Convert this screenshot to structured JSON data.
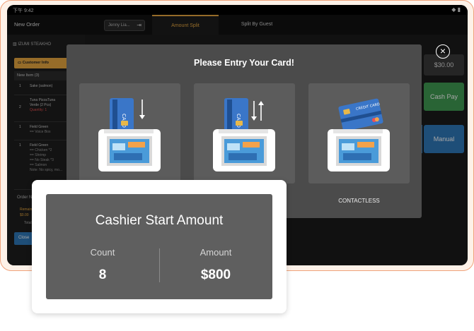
{
  "status_bar": {
    "time": "下午 9:42",
    "icons": "◆ ▮"
  },
  "app_bar": {
    "title": "New Order",
    "user": "Jenny Lia...",
    "tabs": [
      {
        "label": "Amount Split"
      },
      {
        "label": "Split By Guest"
      }
    ]
  },
  "order_panel": {
    "store": "IZUMI STEAKHO",
    "customer_info": "Customer Info",
    "new_item": "New Item (3)",
    "rows": [
      {
        "qty": "1",
        "name": "Sake (salmon)",
        "mods": []
      },
      {
        "qty": "2",
        "name": "Tuna PizzaTuna",
        "mods": [
          "Verde (2 Pcs)",
          "Quantity: 1"
        ]
      },
      {
        "qty": "1",
        "name": "Field Green",
        "mods": [
          "== Voice Box"
        ]
      },
      {
        "qty": "1",
        "name": "Field Green",
        "mods": [
          "== Chicken *2",
          "== Shrimp",
          "== No Steak *3",
          "== Salmon",
          "Note: No spicy, mo..."
        ]
      }
    ],
    "order_number": "Order N",
    "remain_label": "Remain",
    "remain_value": "$0.00",
    "total_label": "Total",
    "close_label": "Close"
  },
  "right_buttons": {
    "amount": "$30.00",
    "cash": "Cash Pay",
    "manual": "Manual"
  },
  "card_modal": {
    "title": "Please Entry Your Card!",
    "options": [
      {
        "label": "",
        "icon": "insert-card-icon"
      },
      {
        "label": "",
        "icon": "swipe-card-icon"
      },
      {
        "label": "CONTACTLESS",
        "icon": "contactless-card-icon"
      }
    ],
    "close_icon": "×"
  },
  "cashier_popup": {
    "title": "Cashier Start Amount",
    "count_label": "Count",
    "count_value": "8",
    "amount_label": "Amount",
    "amount_value": "$800"
  },
  "colors": {
    "accent": "#e6a640",
    "cash": "#3f9a52",
    "manual": "#2f78b8",
    "frame": "#f0a27a"
  }
}
